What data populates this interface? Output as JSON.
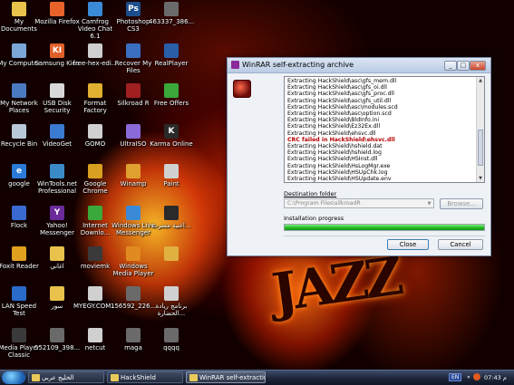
{
  "desktop": {
    "icons": [
      {
        "label": "My Documents",
        "icon": "folder-icon",
        "color": "#e8c24a",
        "glyph": ""
      },
      {
        "label": "Mozilla Firefox",
        "icon": "firefox-icon",
        "color": "#e8632a",
        "glyph": ""
      },
      {
        "label": "Camfrog Video Chat 6.1",
        "icon": "camfrog-icon",
        "color": "#3a8ad8",
        "glyph": ""
      },
      {
        "label": "Photoshop CS3",
        "icon": "photoshop-icon",
        "color": "#1c4d8c",
        "glyph": "Ps"
      },
      {
        "label": "463337_386...",
        "icon": "image-file-icon",
        "color": "#6a6a6a",
        "glyph": ""
      },
      {
        "label": "My Computer",
        "icon": "computer-icon",
        "color": "#7aa7d8",
        "glyph": ""
      },
      {
        "label": "Samsung Kies",
        "icon": "kies-icon",
        "color": "#e0602a",
        "glyph": "KI"
      },
      {
        "label": "free-hex-edi...",
        "icon": "installer-icon",
        "color": "#cfcfcf",
        "glyph": ""
      },
      {
        "label": "Recover My Files",
        "icon": "recover-icon",
        "color": "#3a6fc0",
        "glyph": ""
      },
      {
        "label": "RealPlayer",
        "icon": "realplayer-icon",
        "color": "#2a5fa8",
        "glyph": ""
      },
      {
        "label": "My Network Places",
        "icon": "network-icon",
        "color": "#4a7ac0",
        "glyph": ""
      },
      {
        "label": "USB Disk Security",
        "icon": "usb-icon",
        "color": "#d8d8d8",
        "glyph": ""
      },
      {
        "label": "Format Factory",
        "icon": "format-factory-icon",
        "color": "#e0b030",
        "glyph": ""
      },
      {
        "label": "Silkroad R",
        "icon": "silkroad-icon",
        "color": "#a02020",
        "glyph": ""
      },
      {
        "label": "Free Offers",
        "icon": "offers-icon",
        "color": "#3aa83a",
        "glyph": ""
      },
      {
        "label": "Recycle Bin",
        "icon": "recycle-bin-icon",
        "color": "#b8c8d8",
        "glyph": ""
      },
      {
        "label": "VideoGet",
        "icon": "videoget-icon",
        "color": "#3a7ad0",
        "glyph": ""
      },
      {
        "label": "GOMO",
        "icon": "gom-icon",
        "color": "#d0d0d0",
        "glyph": ""
      },
      {
        "label": "UltraISO",
        "icon": "ultraiso-icon",
        "color": "#8a6ad8",
        "glyph": ""
      },
      {
        "label": "Karma Online",
        "icon": "karma-icon",
        "color": "#2a2a2a",
        "glyph": "K"
      },
      {
        "label": "google",
        "icon": "ie-icon",
        "color": "#2a7ad8",
        "glyph": "e"
      },
      {
        "label": "WinTools.net Professional",
        "icon": "wintools-icon",
        "color": "#3a8ac8",
        "glyph": ""
      },
      {
        "label": "Google Chrome",
        "icon": "chrome-icon",
        "color": "#d8a020",
        "glyph": ""
      },
      {
        "label": "Winamp",
        "icon": "winamp-icon",
        "color": "#e0a030",
        "glyph": ""
      },
      {
        "label": "Paint",
        "icon": "paint-icon",
        "color": "#d0d0d0",
        "glyph": ""
      },
      {
        "label": "Flock",
        "icon": "flock-icon",
        "color": "#3a6ad0",
        "glyph": ""
      },
      {
        "label": "Yahoo! Messenger",
        "icon": "yahoo-icon",
        "color": "#6a2a9a",
        "glyph": "Y"
      },
      {
        "label": "Internet Downlo...",
        "icon": "idm-icon",
        "color": "#3aa83a",
        "glyph": ""
      },
      {
        "label": "Windows Live Messenger",
        "icon": "messenger-icon",
        "color": "#3a8ad8",
        "glyph": ""
      },
      {
        "label": "اغنية مسرت...",
        "icon": "audio-file-icon",
        "color": "#2a2a2a",
        "glyph": ""
      },
      {
        "label": "Foxit Reader",
        "icon": "foxit-icon",
        "color": "#e0a020",
        "glyph": ""
      },
      {
        "label": "اغاني",
        "icon": "folder-icon",
        "color": "#e8c24a",
        "glyph": ""
      },
      {
        "label": "moviemk",
        "icon": "moviemaker-icon",
        "color": "#3a3a3a",
        "glyph": ""
      },
      {
        "label": "Windows Media Player",
        "icon": "wmp-icon",
        "color": "#e08a20",
        "glyph": ""
      },
      {
        "label": "",
        "icon": "music-file-icon",
        "color": "#e0b040",
        "glyph": ""
      },
      {
        "label": "LAN Speed Test",
        "icon": "lan-speed-icon",
        "color": "#2a6ac8",
        "glyph": ""
      },
      {
        "label": "سور",
        "icon": "folder-icon",
        "color": "#e8c24a",
        "glyph": ""
      },
      {
        "label": "MYEGY.COM...",
        "icon": "scissors-icon",
        "color": "#d0d0d0",
        "glyph": ""
      },
      {
        "label": "156592_226...",
        "icon": "image-file-icon",
        "color": "#6a6a6a",
        "glyph": ""
      },
      {
        "label": "برنامج ريادة الحضارة...",
        "icon": "app-icon",
        "color": "#d0d0d0",
        "glyph": ""
      },
      {
        "label": "Media Player Classic",
        "icon": "mpc-icon",
        "color": "#3a3a3a",
        "glyph": ""
      },
      {
        "label": "552109_398...",
        "icon": "image-file-icon",
        "color": "#6a6a6a",
        "glyph": ""
      },
      {
        "label": "netcut",
        "icon": "netcut-icon",
        "color": "#d0d0d0",
        "glyph": ""
      },
      {
        "label": "maga",
        "icon": "image-file-icon",
        "color": "#6a6a6a",
        "glyph": ""
      },
      {
        "label": "qqqq",
        "icon": "image-file-icon",
        "color": "#6a6a6a",
        "glyph": ""
      }
    ]
  },
  "dialog": {
    "title": "WinRAR self-extracting archive",
    "log_lines": [
      {
        "text": "Extracting HackShield\\asc\\gfs_mem.dll",
        "error": false
      },
      {
        "text": "Extracting HackShield\\asc\\gfs_oi.dll",
        "error": false
      },
      {
        "text": "Extracting HackShield\\asc\\gfs_proc.dll",
        "error": false
      },
      {
        "text": "Extracting HackShield\\asc\\gfs_util.dll",
        "error": false
      },
      {
        "text": "Extracting HackShield\\asc\\modules.scd",
        "error": false
      },
      {
        "text": "Extracting HackShield\\asc\\option.scd",
        "error": false
      },
      {
        "text": "Extracting HackShield\\BldInfo.ini",
        "error": false
      },
      {
        "text": "Extracting HackShield\\Ez32Ex.dll",
        "error": false
      },
      {
        "text": "Extracting HackShield\\ehsvc.dll",
        "error": false
      },
      {
        "text": "CRC failed in HackShield\\ehsvc.dll",
        "error": true
      },
      {
        "text": "Extracting HackShield\\hshield.dat",
        "error": false
      },
      {
        "text": "Extracting HackShield\\hshield.log",
        "error": false
      },
      {
        "text": "Extracting HackShield\\HSInst.dll",
        "error": false
      },
      {
        "text": "Extracting HackShield\\HsLogMgr.exe",
        "error": false
      },
      {
        "text": "Extracting HackShield\\HSUpChk.log",
        "error": false
      },
      {
        "text": "Extracting HackShield\\HSUpdate.env",
        "error": false
      }
    ],
    "dest_label": "Destination folder",
    "dest_value": "C:\\Program Files\\silkroadR",
    "browse_label": "Browse...",
    "progress_label": "Installation progress",
    "progress_percent": 100,
    "close_label": "Close",
    "cancel_label": "Cancel"
  },
  "taskbar": {
    "items": [
      {
        "label": "الخليج عربي",
        "active": false
      },
      {
        "label": "HackShield",
        "active": false
      },
      {
        "label": "WinRAR self-extractin...",
        "active": true
      }
    ],
    "lang": "EN",
    "time": "07:43 م"
  },
  "wallpaper_text": "JAZZ"
}
